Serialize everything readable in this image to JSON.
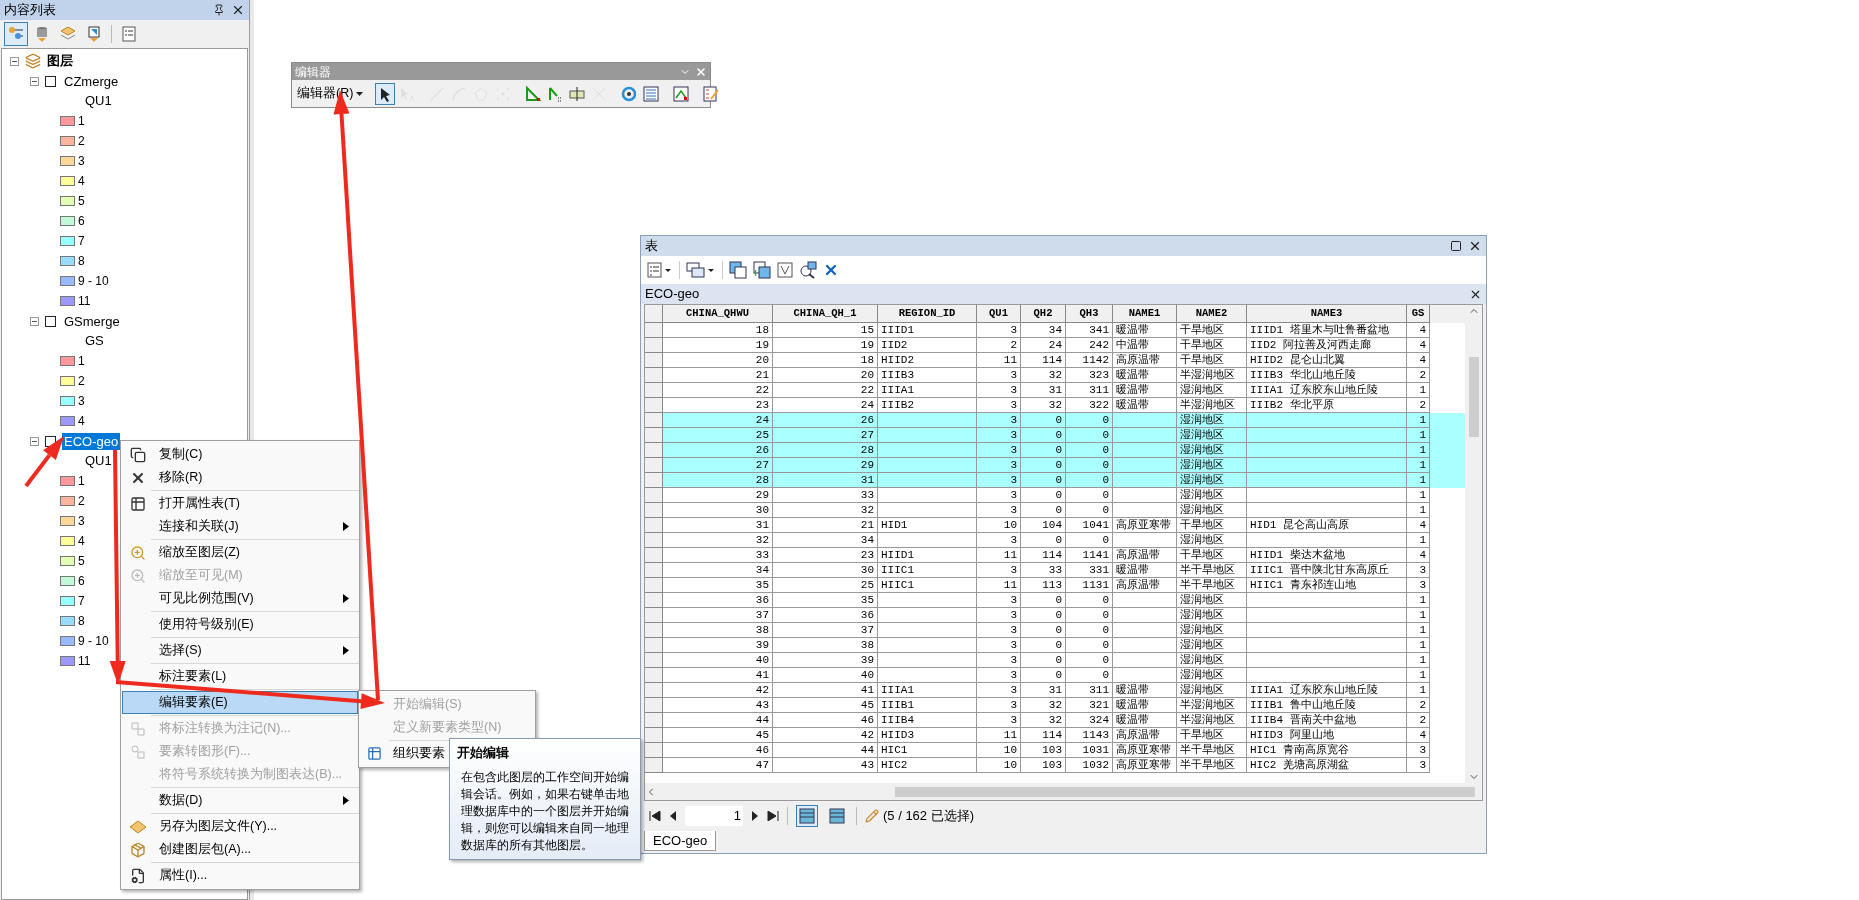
{
  "toc": {
    "title": "内容列表",
    "tools": [
      {
        "selected": true
      },
      {
        "selected": false
      },
      {
        "selected": false
      },
      {
        "selected": false
      },
      {
        "selected": false
      }
    ],
    "root": {
      "label": "图层",
      "expanded": true,
      "layers": [
        {
          "name": "CZmerge",
          "checked": false,
          "expanded": true,
          "selected": false,
          "field": "QU1",
          "classes": [
            {
              "label": "1",
              "color": "#ff9999"
            },
            {
              "label": "2",
              "color": "#ffb59b"
            },
            {
              "label": "3",
              "color": "#ffd79b"
            },
            {
              "label": "4",
              "color": "#ffff99"
            },
            {
              "label": "5",
              "color": "#e1ffb4"
            },
            {
              "label": "6",
              "color": "#c1f9d7"
            },
            {
              "label": "7",
              "color": "#99ffff"
            },
            {
              "label": "8",
              "color": "#99dbff"
            },
            {
              "label": "9 - 10",
              "color": "#99b8ff"
            },
            {
              "label": "11",
              "color": "#9999ff"
            }
          ]
        },
        {
          "name": "GSmerge",
          "checked": false,
          "expanded": true,
          "selected": false,
          "field": "GS",
          "classes": [
            {
              "label": "1",
              "color": "#ff9999"
            },
            {
              "label": "2",
              "color": "#ffff99"
            },
            {
              "label": "3",
              "color": "#99ffff"
            },
            {
              "label": "4",
              "color": "#9999ff"
            }
          ]
        },
        {
          "name": "ECO-geo",
          "checked": false,
          "expanded": true,
          "selected": true,
          "field": "QU1",
          "classes": [
            {
              "label": "1",
              "color": "#ff9999"
            },
            {
              "label": "2",
              "color": "#ffb59b"
            },
            {
              "label": "3",
              "color": "#ffd79b"
            },
            {
              "label": "4",
              "color": "#ffff99"
            },
            {
              "label": "5",
              "color": "#e1ffb4"
            },
            {
              "label": "6",
              "color": "#c1f9d7"
            },
            {
              "label": "7",
              "color": "#99ffff"
            },
            {
              "label": "8",
              "color": "#99dbff"
            },
            {
              "label": "9 - 10",
              "color": "#99b8ff"
            },
            {
              "label": "11",
              "color": "#9999ff"
            }
          ]
        }
      ]
    }
  },
  "editor_toolbar": {
    "title": "编辑器",
    "menu_button": "编辑器(R)",
    "tools": [
      {
        "selected": true,
        "disabled": false
      },
      {
        "selected": false,
        "disabled": true
      },
      {
        "selected": false,
        "disabled": true
      },
      {
        "selected": false,
        "disabled": true
      },
      {
        "selected": false,
        "disabled": true
      },
      {
        "selected": false,
        "disabled": true
      },
      {
        "selected": false,
        "disabled": false
      },
      {
        "selected": false,
        "disabled": false
      },
      {
        "selected": false,
        "disabled": false
      },
      {
        "selected": false,
        "disabled": true
      },
      {
        "selected": false,
        "disabled": false
      },
      {
        "selected": false,
        "disabled": false
      },
      {
        "selected": false,
        "disabled": false
      },
      {
        "selected": false,
        "disabled": false
      }
    ]
  },
  "context_menu": {
    "groups": [
      [
        {
          "label": "复制(C)",
          "disabled": false,
          "submenu": false,
          "selected": false
        },
        {
          "label": "移除(R)",
          "disabled": false,
          "submenu": false,
          "selected": false
        }
      ],
      [
        {
          "label": "打开属性表(T)",
          "disabled": false,
          "submenu": false,
          "selected": false
        },
        {
          "label": "连接和关联(J)",
          "disabled": false,
          "submenu": true,
          "selected": false
        }
      ],
      [
        {
          "label": "缩放至图层(Z)",
          "disabled": false,
          "submenu": false,
          "selected": false
        },
        {
          "label": "缩放至可见(M)",
          "disabled": true,
          "submenu": false,
          "selected": false
        },
        {
          "label": "可见比例范围(V)",
          "disabled": false,
          "submenu": true,
          "selected": false
        }
      ],
      [
        {
          "label": "使用符号级别(E)",
          "disabled": false,
          "submenu": false,
          "selected": false
        }
      ],
      [
        {
          "label": "选择(S)",
          "disabled": false,
          "submenu": true,
          "selected": false
        }
      ],
      [
        {
          "label": "标注要素(L)",
          "disabled": false,
          "submenu": false,
          "selected": false
        }
      ],
      [
        {
          "label": "编辑要素(E)",
          "disabled": false,
          "submenu": false,
          "selected": true
        }
      ],
      [
        {
          "label": "将标注转换为注记(N)...",
          "disabled": true,
          "submenu": false,
          "selected": false
        },
        {
          "label": "要素转图形(F)...",
          "disabled": true,
          "submenu": false,
          "selected": false
        },
        {
          "label": "将符号系统转换为制图表达(B)...",
          "disabled": true,
          "submenu": false,
          "selected": false
        }
      ],
      [
        {
          "label": "数据(D)",
          "disabled": false,
          "submenu": true,
          "selected": false
        }
      ],
      [
        {
          "label": "另存为图层文件(Y)...",
          "disabled": false,
          "submenu": false,
          "selected": false
        },
        {
          "label": "创建图层包(A)...",
          "disabled": false,
          "submenu": false,
          "selected": false
        }
      ],
      [
        {
          "label": "属性(I)...",
          "disabled": false,
          "submenu": false,
          "selected": false
        }
      ]
    ]
  },
  "submenu": {
    "groups": [
      [
        {
          "label": "开始编辑(S)",
          "disabled": true
        },
        {
          "label": "定义新要素类型(N)",
          "disabled": true
        }
      ],
      [
        {
          "label": "组织要素",
          "disabled": false
        }
      ]
    ]
  },
  "tooltip": {
    "title": "开始编辑",
    "text": "在包含此图层的工作空间开始编辑会话。例如，如果右键单击地理数据库中的一个图层并开始编辑，则您可以编辑来自同一地理数据库的所有其他图层。"
  },
  "table_window": {
    "title": "表",
    "table_name": "ECO-geo",
    "columns": [
      "CHINA_QHWU",
      "CHINA_QH_1",
      "REGION_ID",
      "QU1",
      "QH2",
      "QH3",
      "NAME1",
      "NAME2",
      "NAME3",
      "GS"
    ],
    "rows": [
      {
        "selected": false,
        "cells": [
          "18",
          "15",
          "IIID1",
          "3",
          "34",
          "341",
          "暖温带",
          "干旱地区",
          "IIID1 塔里木与吐鲁番盆地",
          "4"
        ]
      },
      {
        "selected": false,
        "cells": [
          "19",
          "19",
          "IID2",
          "2",
          "24",
          "242",
          "中温带",
          "干旱地区",
          "IID2 阿拉善及河西走廊",
          "4"
        ]
      },
      {
        "selected": false,
        "cells": [
          "20",
          "18",
          "HIID2",
          "11",
          "114",
          "1142",
          "高原温带",
          "干旱地区",
          "HIID2 昆仑山北翼",
          "4"
        ]
      },
      {
        "selected": false,
        "cells": [
          "21",
          "20",
          "IIIB3",
          "3",
          "32",
          "323",
          "暖温带",
          "半湿润地区",
          "IIIB3 华北山地丘陵",
          "2"
        ]
      },
      {
        "selected": false,
        "cells": [
          "22",
          "22",
          "IIIA1",
          "3",
          "31",
          "311",
          "暖温带",
          "湿润地区",
          "IIIA1 辽东胶东山地丘陵",
          "1"
        ]
      },
      {
        "selected": false,
        "cells": [
          "23",
          "24",
          "IIIB2",
          "3",
          "32",
          "322",
          "暖温带",
          "半湿润地区",
          "IIIB2 华北平原",
          "2"
        ]
      },
      {
        "selected": true,
        "cells": [
          "24",
          "26",
          null,
          "3",
          "0",
          "0",
          null,
          "湿润地区",
          null,
          "1"
        ]
      },
      {
        "selected": true,
        "cells": [
          "25",
          "27",
          null,
          "3",
          "0",
          "0",
          null,
          "湿润地区",
          null,
          "1"
        ]
      },
      {
        "selected": true,
        "cells": [
          "26",
          "28",
          null,
          "3",
          "0",
          "0",
          null,
          "湿润地区",
          null,
          "1"
        ]
      },
      {
        "selected": true,
        "cells": [
          "27",
          "29",
          null,
          "3",
          "0",
          "0",
          null,
          "湿润地区",
          null,
          "1"
        ]
      },
      {
        "selected": true,
        "cells": [
          "28",
          "31",
          null,
          "3",
          "0",
          "0",
          null,
          "湿润地区",
          null,
          "1"
        ]
      },
      {
        "selected": false,
        "cells": [
          "29",
          "33",
          null,
          "3",
          "0",
          "0",
          null,
          "湿润地区",
          null,
          "1"
        ]
      },
      {
        "selected": false,
        "cells": [
          "30",
          "32",
          null,
          "3",
          "0",
          "0",
          null,
          "湿润地区",
          null,
          "1"
        ]
      },
      {
        "selected": false,
        "cells": [
          "31",
          "21",
          "HID1",
          "10",
          "104",
          "1041",
          "高原亚寒带",
          "干旱地区",
          "HID1 昆仑高山高原",
          "4"
        ]
      },
      {
        "selected": false,
        "cells": [
          "32",
          "34",
          null,
          "3",
          "0",
          "0",
          null,
          "湿润地区",
          null,
          "1"
        ]
      },
      {
        "selected": false,
        "cells": [
          "33",
          "23",
          "HIID1",
          "11",
          "114",
          "1141",
          "高原温带",
          "干旱地区",
          "HIID1 柴达木盆地",
          "4"
        ]
      },
      {
        "selected": false,
        "cells": [
          "34",
          "30",
          "IIIC1",
          "3",
          "33",
          "331",
          "暖温带",
          "半干旱地区",
          "IIIC1 晋中陕北甘东高原丘",
          "3"
        ]
      },
      {
        "selected": false,
        "cells": [
          "35",
          "25",
          "HIIC1",
          "11",
          "113",
          "1131",
          "高原温带",
          "半干旱地区",
          "HIIC1 青东祁连山地",
          "3"
        ]
      },
      {
        "selected": false,
        "cells": [
          "36",
          "35",
          null,
          "3",
          "0",
          "0",
          null,
          "湿润地区",
          null,
          "1"
        ]
      },
      {
        "selected": false,
        "cells": [
          "37",
          "36",
          null,
          "3",
          "0",
          "0",
          null,
          "湿润地区",
          null,
          "1"
        ]
      },
      {
        "selected": false,
        "cells": [
          "38",
          "37",
          null,
          "3",
          "0",
          "0",
          null,
          "湿润地区",
          null,
          "1"
        ]
      },
      {
        "selected": false,
        "cells": [
          "39",
          "38",
          null,
          "3",
          "0",
          "0",
          null,
          "湿润地区",
          null,
          "1"
        ]
      },
      {
        "selected": false,
        "cells": [
          "40",
          "39",
          null,
          "3",
          "0",
          "0",
          null,
          "湿润地区",
          null,
          "1"
        ]
      },
      {
        "selected": false,
        "cells": [
          "41",
          "40",
          null,
          "3",
          "0",
          "0",
          null,
          "湿润地区",
          null,
          "1"
        ]
      },
      {
        "selected": false,
        "cells": [
          "42",
          "41",
          "IIIA1",
          "3",
          "31",
          "311",
          "暖温带",
          "湿润地区",
          "IIIA1 辽东胶东山地丘陵",
          "1"
        ]
      },
      {
        "selected": false,
        "cells": [
          "43",
          "45",
          "IIIB1",
          "3",
          "32",
          "321",
          "暖温带",
          "半湿润地区",
          "IIIB1 鲁中山地丘陵",
          "2"
        ]
      },
      {
        "selected": false,
        "cells": [
          "44",
          "46",
          "IIIB4",
          "3",
          "32",
          "324",
          "暖温带",
          "半湿润地区",
          "IIIB4 晋南关中盆地",
          "2"
        ]
      },
      {
        "selected": false,
        "cells": [
          "45",
          "42",
          "HIID3",
          "11",
          "114",
          "1143",
          "高原温带",
          "干旱地区",
          "HIID3 阿里山地",
          "4"
        ]
      },
      {
        "selected": false,
        "cells": [
          "46",
          "44",
          "HIC1",
          "10",
          "103",
          "1031",
          "高原亚寒带",
          "半干旱地区",
          "HIC1 青南高原宽谷",
          "3"
        ]
      },
      {
        "selected": false,
        "cells": [
          "47",
          "43",
          "HIC2",
          "10",
          "103",
          "1032",
          "高原亚寒带",
          "半干旱地区",
          "HIC2 羌塘高原湖盆",
          "3"
        ]
      }
    ],
    "page": "1",
    "views": [
      {
        "selected": true
      },
      {
        "selected": false
      }
    ],
    "status": "(5 / 162 已选择)",
    "tab": "ECO-geo"
  }
}
